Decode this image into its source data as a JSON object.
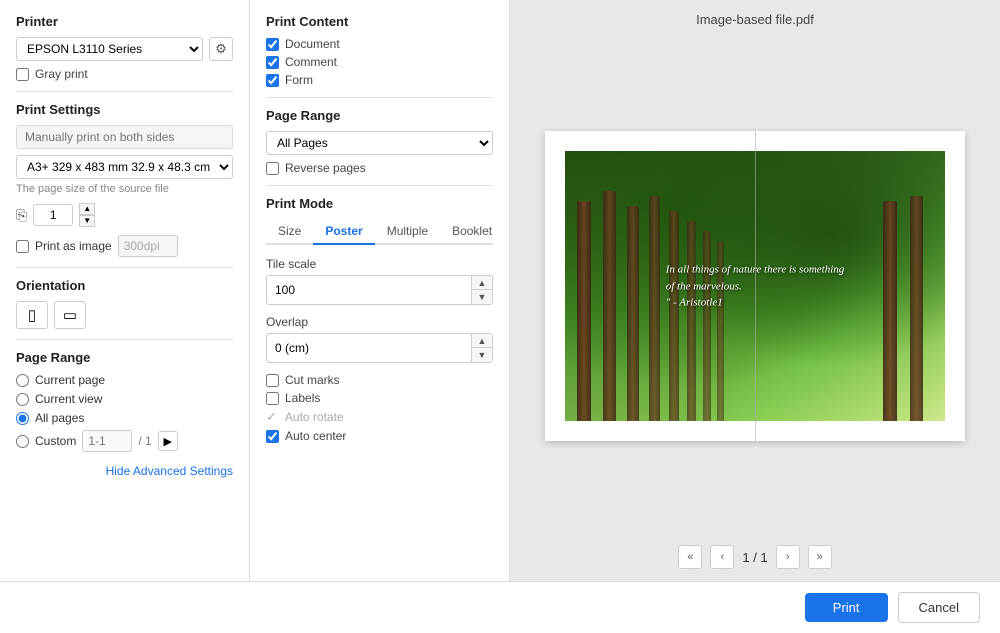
{
  "header": {
    "preview_title": "Image-based file.pdf"
  },
  "left_panel": {
    "printer_section": "Printer",
    "printer_name": "EPSON L3110 Series",
    "gray_print_label": "Gray print",
    "print_settings_section": "Print Settings",
    "both_sides_placeholder": "Manually print on both sides",
    "page_size_value": "A3+ 329 x 483 mm 32.9 x 48.3 cm",
    "source_hint": "The page size of the source file",
    "copies_value": "1",
    "print_as_image_label": "Print as image",
    "dpi_value": "300dpi",
    "orientation_section": "Orientation",
    "page_range_section": "Page Range",
    "current_page_label": "Current page",
    "current_view_label": "Current view",
    "all_pages_label": "All pages",
    "custom_label": "Custom",
    "custom_placeholder": "1-1",
    "custom_total": "/ 1",
    "hide_advanced": "Hide Advanced Settings"
  },
  "middle_panel": {
    "print_content_section": "Print Content",
    "document_label": "Document",
    "comment_label": "Comment",
    "form_label": "Form",
    "page_range_section": "Page Range",
    "all_pages_option": "All Pages",
    "reverse_pages_label": "Reverse pages",
    "print_mode_section": "Print Mode",
    "tabs": [
      "Size",
      "Poster",
      "Multiple",
      "Booklet"
    ],
    "active_tab": "Poster",
    "tile_scale_label": "Tile scale",
    "tile_scale_value": "100",
    "overlap_label": "Overlap",
    "overlap_value": "0 (cm)",
    "cut_marks_label": "Cut marks",
    "labels_label": "Labels",
    "auto_rotate_label": "Auto rotate",
    "auto_center_label": "Auto center"
  },
  "preview": {
    "quote_line1": "In all things of nature there is something",
    "quote_line2": "of the marvelous.",
    "quote_line3": "\" - Aristotle1",
    "page_current": "1",
    "page_total": "1"
  },
  "bottom": {
    "print_btn": "Print",
    "cancel_btn": "Cancel"
  }
}
